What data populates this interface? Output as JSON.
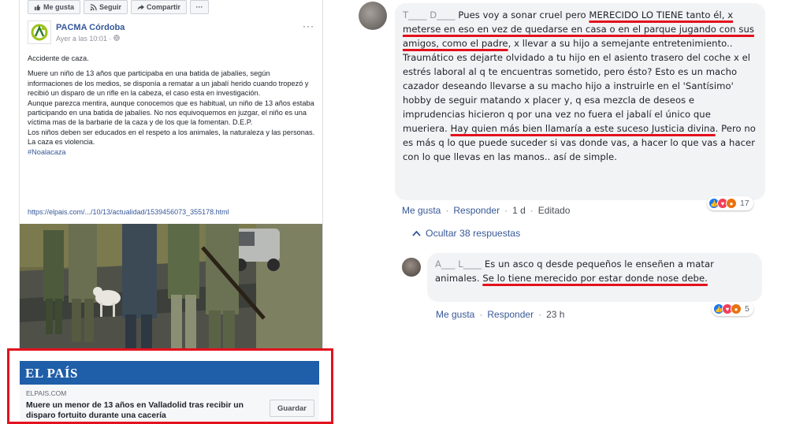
{
  "fb_post": {
    "top_actions": {
      "like": "Me gusta",
      "follow": "Seguir",
      "share": "Compartir",
      "more": "···"
    },
    "page_name": "PACMA Córdoba",
    "time": "Ayer a las 10:01 · ",
    "menu": "···",
    "body": [
      "Accidente de caza.",
      "Muere un niño de 13 años que participaba en una batida de jabalíes, según informaciones de los medios, se disponía a rematar a un jabalí herido cuando tropezó y recibió un disparo de un rifle en la cabeza, el caso esta en investigación.",
      "Aunque parezca mentira, aunque conocemos que es habitual, un niño de 13 años estaba participando en una batida de jabalíes. No nos equivoquemos en juzgar, el niño es una víctima mas de la barbarie de la caza y de los que la fomentan. D.E.P.",
      "Los niños deben ser educados en el respeto a los animales, la naturaleza y las personas.",
      "La caza es violencia.",
      "#Noalacaza"
    ],
    "link_url": "https://elpais.com/.../10/13/actualidad/1539456073_355178.html",
    "link_card": {
      "logo": "EL PAÍS",
      "domain": "ELPAIS.COM",
      "title": "Muere un menor de 13 años en Valladolid tras recibir un disparo fortuito durante una cacería",
      "save_button": "Guardar",
      "highlight_color": "#e3111d",
      "band_color": "#1f5ea8"
    }
  },
  "comment1": {
    "author": "T____ D____",
    "text_segments": [
      {
        "t": "Pues voy a sonar cruel pero ",
        "u": false
      },
      {
        "t": "MERECIDO LO TIENE tanto él, x meterse en eso en vez de quedarse en casa o en el parque jugando con sus amigos, como el padre",
        "u": true
      },
      {
        "t": ", x llevar a su hijo a semejante entretenimiento.. Traumático es dejarte olvidado a tu hijo en el asiento trasero del coche x el estrés laboral al q te encuentras sometido, pero ésto? Esto es un macho cazador deseando llevarse a su macho hijo a instruirle en el 'Santísimo' hobby de seguir matando x placer y, q esa mezcla de deseos e imprudencias hicieron q por una vez no fuera el jabalí el único que mueriera. ",
        "u": false
      },
      {
        "t": "Hay quien más bien llamaría a este suceso Justicia divina",
        "u": true
      },
      {
        "t": ". Pero no es más q lo que puede suceder si vas donde vas, a hacer lo que vas a hacer con lo que llevas en las manos.. así de simple.",
        "u": false
      }
    ],
    "actions": {
      "like": "Me gusta",
      "reply": "Responder",
      "time": "1 d",
      "edited": "Editado"
    },
    "reaction_count": "17"
  },
  "hide_replies": "Ocultar 38 respuestas",
  "comment2": {
    "author": "A___ L____",
    "text_segments": [
      {
        "t": "Es un asco q desde pequeños le enseñen a matar animales. ",
        "u": false
      },
      {
        "t": "Se lo tiene merecido por estar donde nose debe.",
        "u": true
      }
    ],
    "actions": {
      "like": "Me gusta",
      "reply": "Responder",
      "time": "23 h"
    },
    "reaction_count": "5"
  }
}
